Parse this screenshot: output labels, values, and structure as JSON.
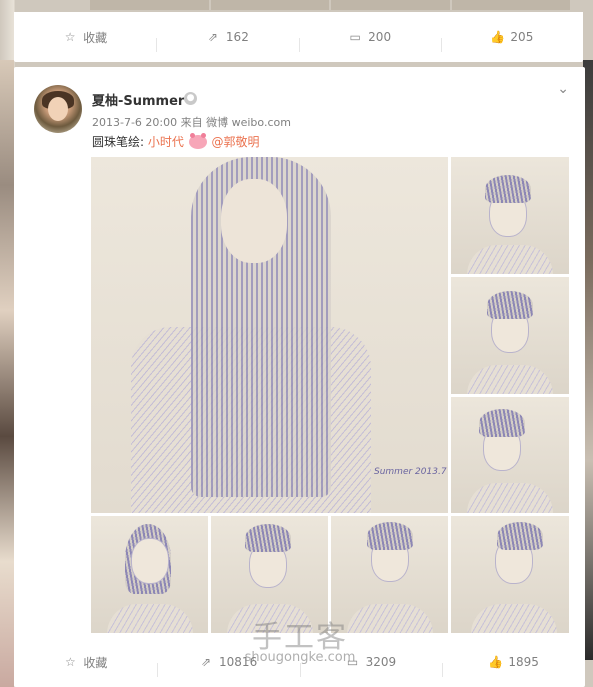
{
  "top_card": {
    "actions": [
      {
        "icon": "star-icon",
        "label": "收藏"
      },
      {
        "icon": "share-icon",
        "label": "162"
      },
      {
        "icon": "comment-icon",
        "label": "200"
      },
      {
        "icon": "like-icon",
        "label": "205"
      }
    ]
  },
  "post": {
    "username": "夏柚-Summer",
    "meta": "2013-7-6 20:00 来自 微博 weibo.com",
    "text_prefix": "圆珠笔绘:",
    "topic": "小时代",
    "mention": "@郭敬明",
    "signature": "Summer 2013.7"
  },
  "card_actions": [
    {
      "icon": "star-icon",
      "label": "收藏"
    },
    {
      "icon": "share-icon",
      "label": "10816"
    },
    {
      "icon": "comment-icon",
      "label": "3209"
    },
    {
      "icon": "like-icon",
      "label": "1895"
    }
  ],
  "watermark": {
    "cn": "手工客",
    "en": "shougongke.com"
  },
  "colors": {
    "accent": "#eb7350",
    "muted": "#808080",
    "card_bg": "#ffffff"
  }
}
